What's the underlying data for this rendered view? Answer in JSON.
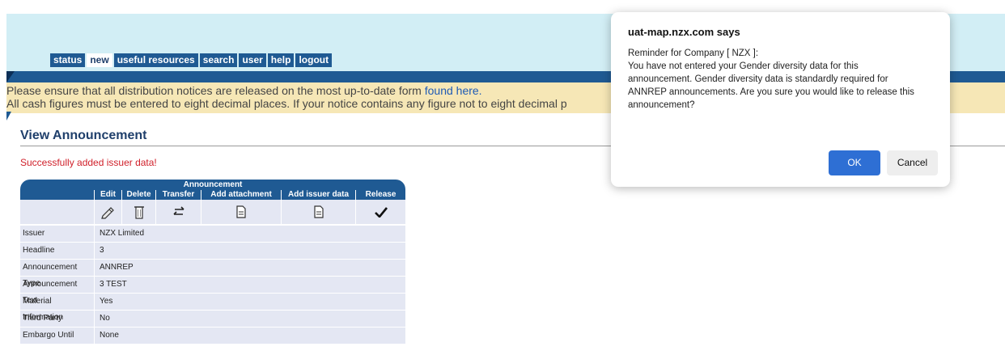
{
  "menu": [
    "status",
    "new",
    "useful resources",
    "search",
    "user",
    "help",
    "logout"
  ],
  "notice": {
    "line1_text": "Please ensure that all distribution notices are released on the most up-to-date form ",
    "line1_link": "found here.",
    "line2_text": "All cash figures must be entered to eight decimal places. If your notice contains any figure not to eight decimal p"
  },
  "page_title": "View Announcement",
  "success_message": "Successfully added issuer data!",
  "announcement": {
    "title": "Announcement",
    "actions": [
      "Edit",
      "Delete",
      "Transfer",
      "Add attachment",
      "Add issuer data",
      "Release"
    ],
    "action_icons": [
      "pencil-icon",
      "trash-icon",
      "transfer-icon",
      "document-icon",
      "document-icon",
      "checkmark-icon"
    ],
    "rows": [
      {
        "label": "Issuer",
        "value": "NZX Limited"
      },
      {
        "label": "Headline",
        "value": "3"
      },
      {
        "label": "Announcement Type",
        "value": "ANNREP"
      },
      {
        "label": "Announcement Text",
        "value": "3 TEST"
      },
      {
        "label": "Material Information",
        "value": "Yes"
      },
      {
        "label": "Third Party",
        "value": "No"
      },
      {
        "label": "Embargo Until",
        "value": "None"
      }
    ]
  },
  "dialog": {
    "title": "uat-map.nzx.com says",
    "message_lines": [
      "Reminder for Company [ NZX ]:",
      "You have not entered your Gender diversity data for this",
      "announcement. Gender diversity data is standardly required for",
      "ANNREP announcements. Are you sure you would like to release this",
      "announcement?"
    ],
    "ok_label": "OK",
    "cancel_label": "Cancel"
  },
  "colors": {
    "banner": "#d2eef5",
    "nav_blue": "#1f5a93",
    "notice_bg": "#f6e7b6",
    "success_red": "#d0202a",
    "ok_blue": "#2e6fd4"
  }
}
